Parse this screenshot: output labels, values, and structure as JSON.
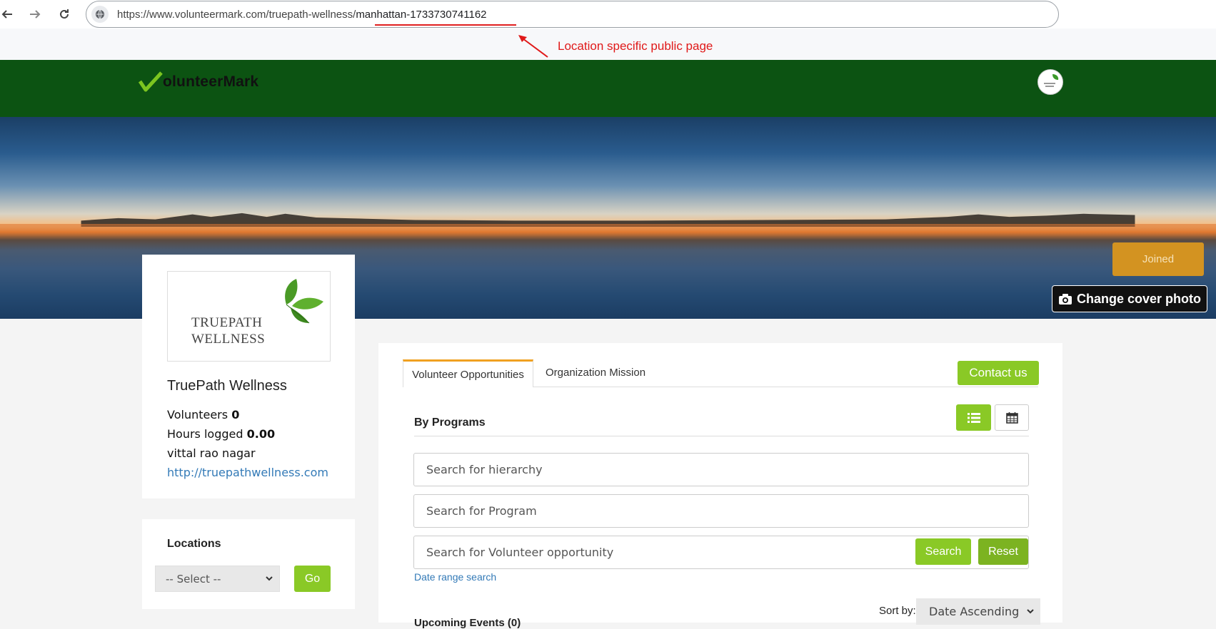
{
  "browser": {
    "url_prefix": "https://www.volunteermark.com/truepath-wellness/",
    "url_location": "manhattan-1733730741162"
  },
  "annotation": {
    "text": "Location specific public page",
    "color": "#e01919"
  },
  "header": {
    "brand": "olunteerMark",
    "brand_color": "#0c5312"
  },
  "cover": {
    "joined_label": "Joined",
    "change_cover_label": "Change cover photo"
  },
  "org": {
    "logo_line1": "TRUEPATH",
    "logo_line2": "WELLNESS",
    "name": "TruePath Wellness",
    "volunteers_label": "Volunteers",
    "volunteers_value": "0",
    "hours_label": "Hours logged",
    "hours_value": "0.00",
    "address": "vittal rao nagar",
    "website": "http://truepathwellness.com"
  },
  "locations": {
    "title": "Locations",
    "select_value": "-- Select --",
    "go_label": "Go"
  },
  "tabs": [
    {
      "label": "Volunteer Opportunities",
      "active": true
    },
    {
      "label": "Organization Mission",
      "active": false
    }
  ],
  "main": {
    "contact_label": "Contact us",
    "section_title": "By Programs",
    "search_hierarchy_placeholder": "Search for hierarchy",
    "search_program_placeholder": "Search for Program",
    "search_opportunity_placeholder": "Search for Volunteer opportunity",
    "search_label": "Search",
    "reset_label": "Reset",
    "date_range_label": "Date range search",
    "sort_label": "Sort by:",
    "sort_value": "Date Ascending",
    "upcoming_events": "Upcoming Events (0)",
    "accent_color": "#8ac926"
  }
}
